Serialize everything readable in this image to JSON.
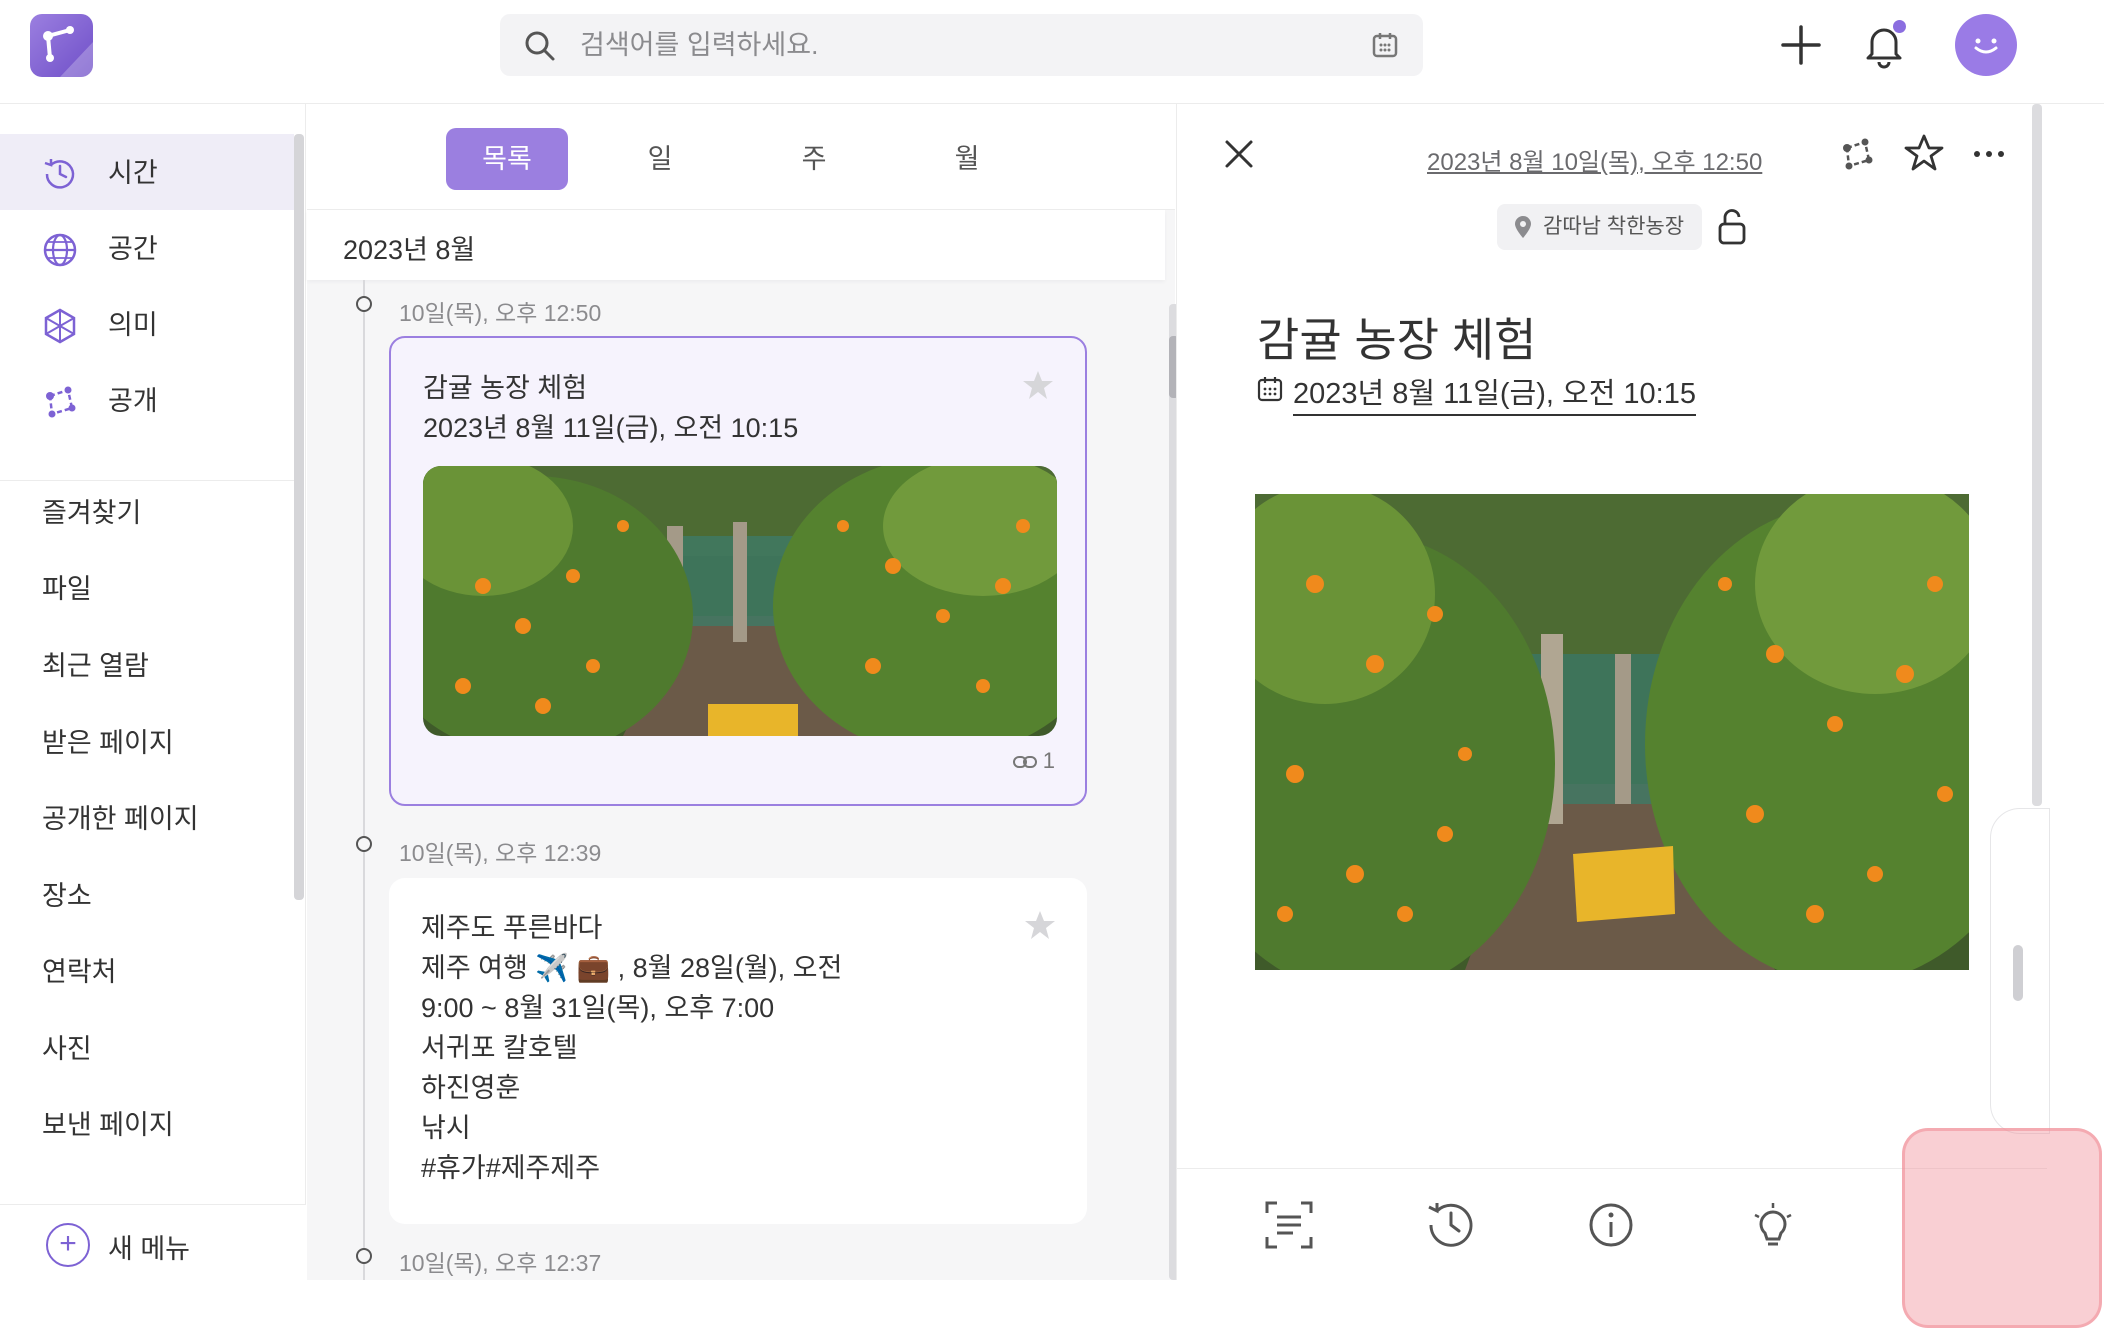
{
  "search": {
    "placeholder": "검색어를 입력하세요."
  },
  "sidebar": {
    "main_items": [
      {
        "label": "시간",
        "icon": "history-clock-icon"
      },
      {
        "label": "공간",
        "icon": "globe-icon"
      },
      {
        "label": "의미",
        "icon": "network-hexagon-icon"
      },
      {
        "label": "공개",
        "icon": "share-nodes-icon"
      }
    ],
    "sub_items": [
      "즐겨찾기",
      "파일",
      "최근 열람",
      "받은 페이지",
      "공개한 페이지",
      "장소",
      "연락처",
      "사진",
      "보낸 페이지"
    ],
    "new_menu_label": "새 메뉴"
  },
  "tabs": {
    "list": "목록",
    "day": "일",
    "week": "주",
    "month": "월"
  },
  "timeline": {
    "month_header": "2023년 8월",
    "entries": [
      {
        "time": "10일(목), 오후 12:50",
        "title": "감귤 농장 체험",
        "date": "2023년 8월 11일(금), 오전 10:15",
        "link_count": "1"
      },
      {
        "time": "10일(목), 오후 12:39",
        "lines": "제주도 푸른바다\n제주 여행 ✈️ 💼 , 8월 28일(월), 오전\n9:00 ~ 8월 31일(목), 오후 7:00\n서귀포 칼호텔\n하진영훈\n낚시\n#휴가#제주제주"
      },
      {
        "time": "10일(목), 오후 12:37"
      }
    ]
  },
  "detail": {
    "created_date": "2023년 8월 10일(목), 오후 12:50",
    "location": "감따남 착한농장",
    "title": "감귤 농장 체험",
    "event_date": "2023년 8월 11일(금), 오전 10:15"
  },
  "colors": {
    "accent": "#9b7fe0",
    "highlight": "#f08c96"
  }
}
